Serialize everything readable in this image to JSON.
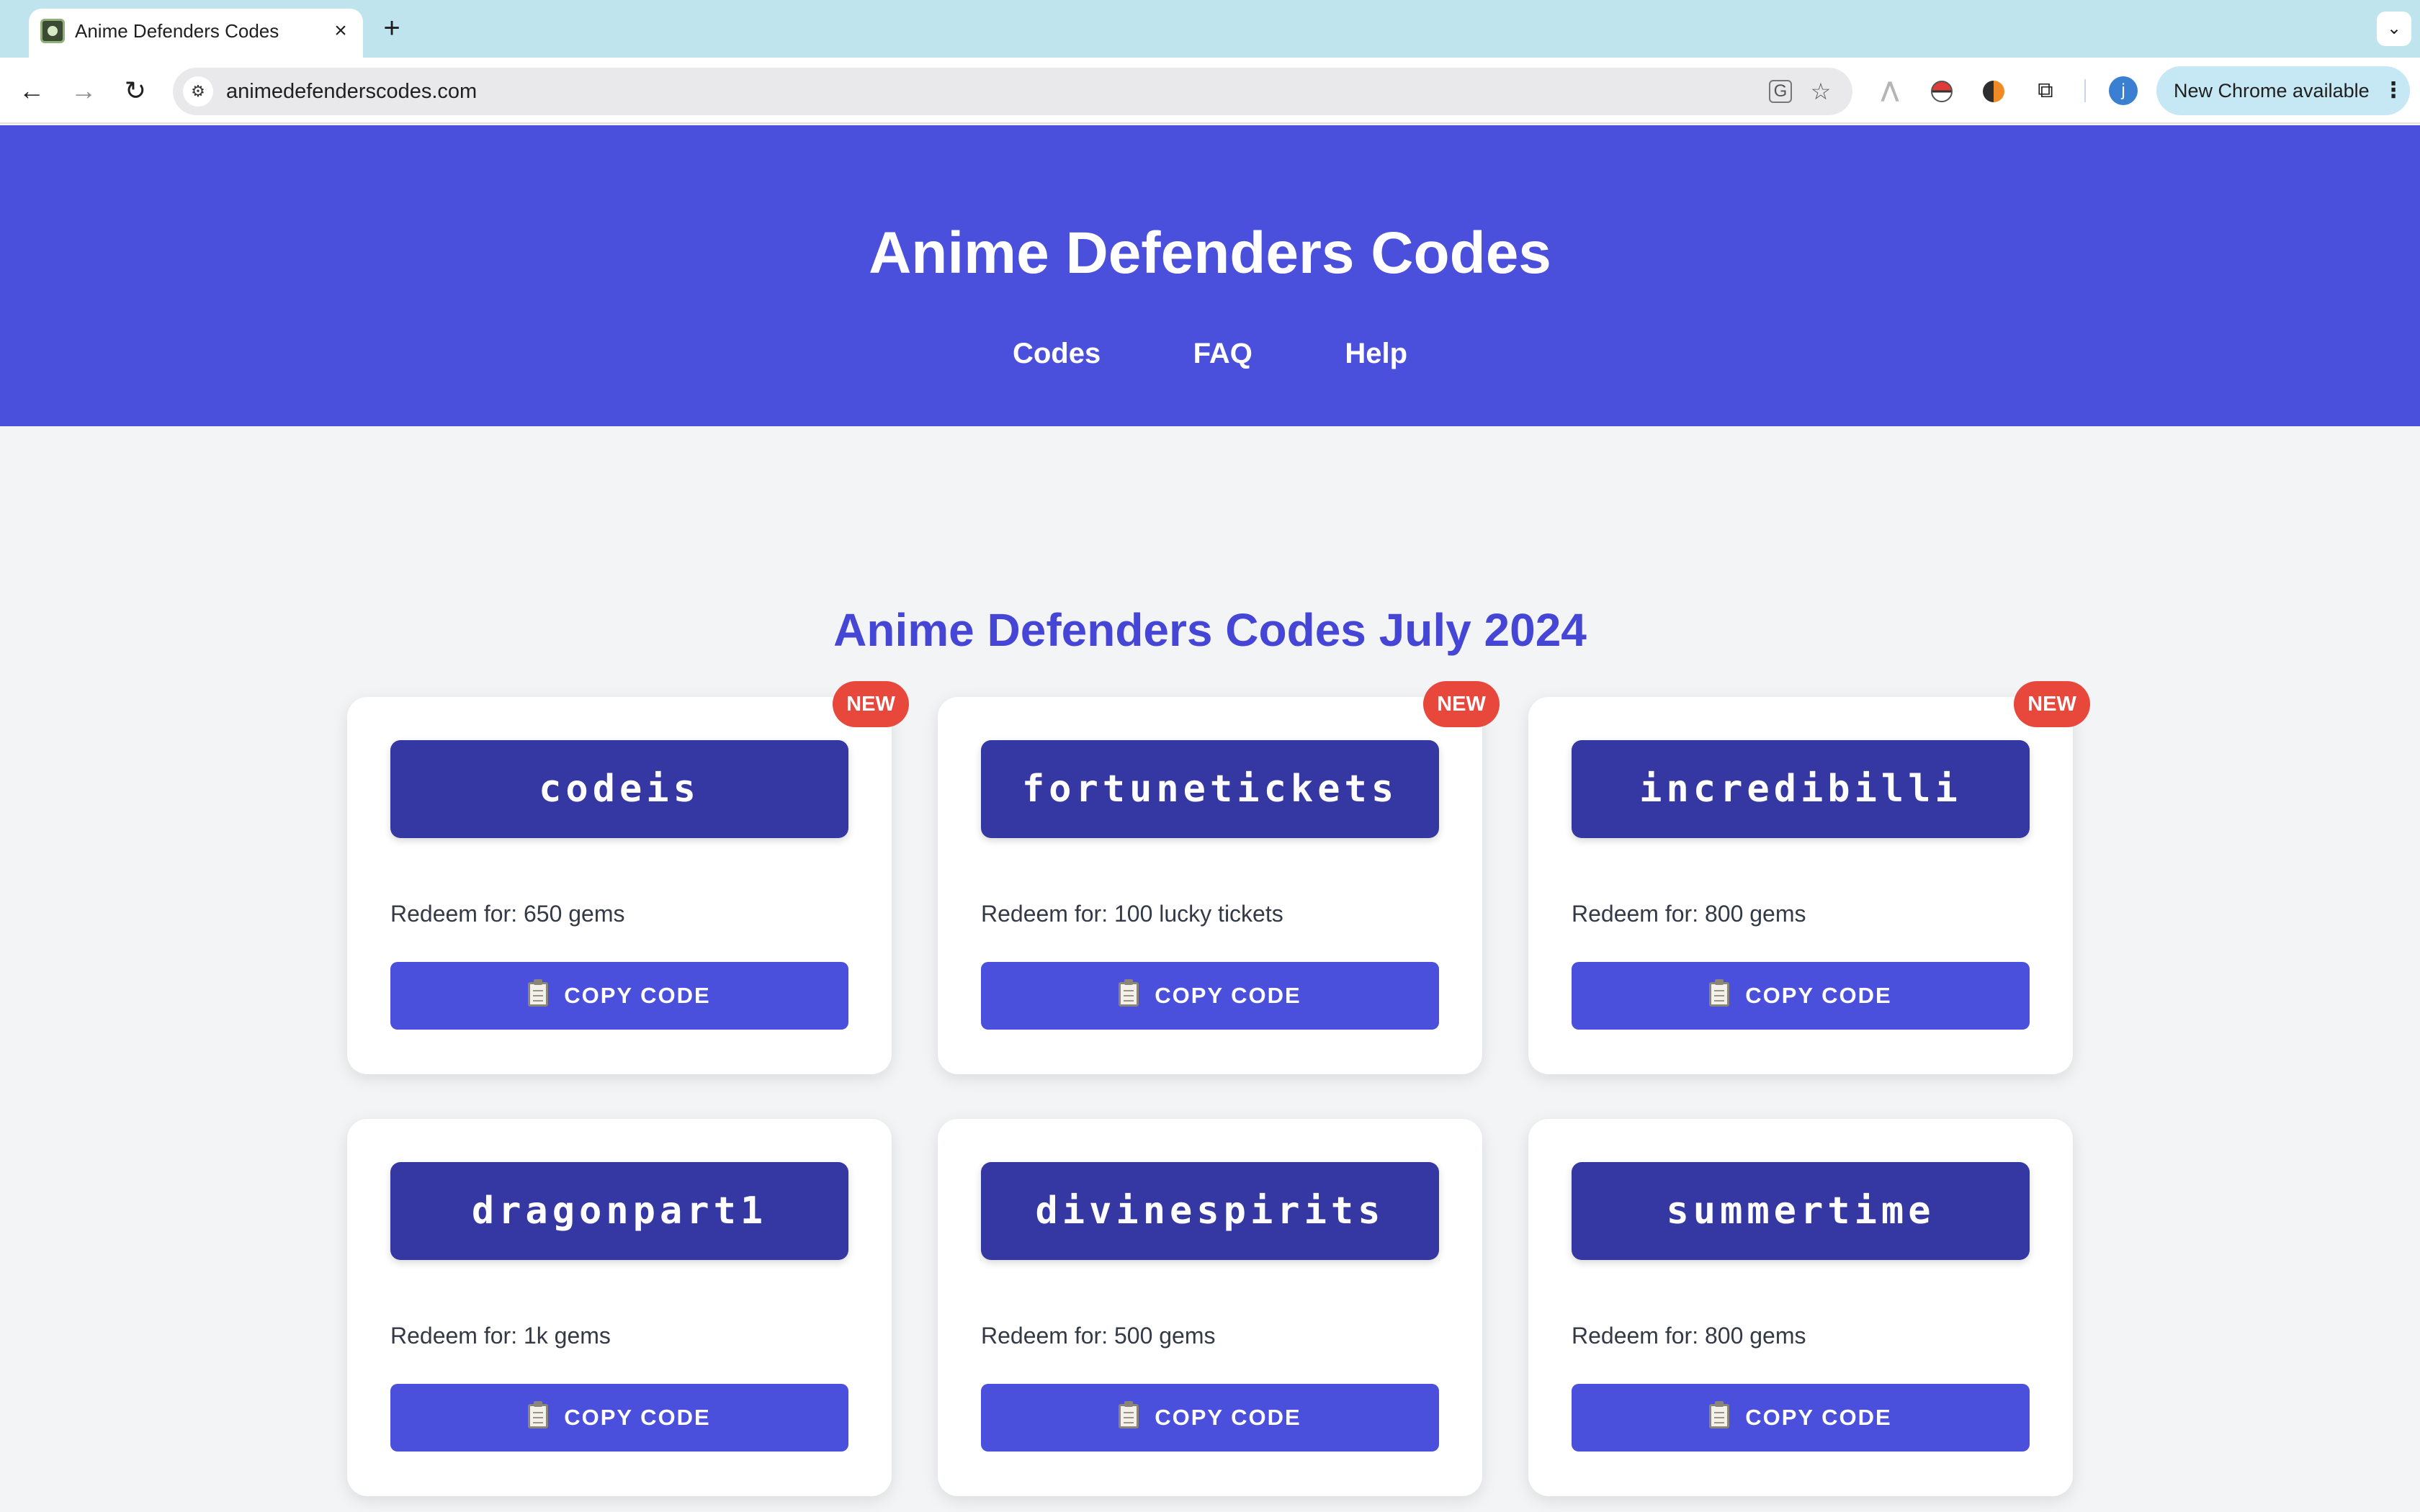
{
  "browser": {
    "tab_title": "Anime Defenders Codes",
    "tab_close": "×",
    "new_tab": "+",
    "tab_search": "⌄",
    "url": "animedefenderscodes.com",
    "update_label": "New Chrome available",
    "profile_initial": "j",
    "icons": {
      "back": "back-arrow-icon",
      "forward": "forward-arrow-icon",
      "reload": "reload-icon",
      "site_info": "tune-icon",
      "translate": "translate-icon",
      "bookmark": "star-icon",
      "extensions": "puzzle-icon",
      "menu": "kebab-menu-icon"
    }
  },
  "header": {
    "title": "Anime Defenders Codes",
    "nav": [
      "Codes",
      "FAQ",
      "Help"
    ],
    "color": "#4a4fdc"
  },
  "main": {
    "heading": "Anime Defenders Codes July 2024",
    "copy_label": "COPY CODE",
    "badge_label": "NEW",
    "cards": [
      {
        "code": "codeis",
        "reward": "Redeem for: 650 gems",
        "is_new": true
      },
      {
        "code": "fortunetickets",
        "reward": "Redeem for: 100 lucky tickets",
        "is_new": true
      },
      {
        "code": "incredibilli",
        "reward": "Redeem for: 800 gems",
        "is_new": true
      },
      {
        "code": "dragonpart1",
        "reward": "Redeem for: 1k gems",
        "is_new": false
      },
      {
        "code": "divinespirits",
        "reward": "Redeem for: 500 gems",
        "is_new": false
      },
      {
        "code": "summertime",
        "reward": "Redeem for: 800 gems",
        "is_new": false
      }
    ]
  },
  "colors": {
    "tabstrip": "#bfe4ee",
    "header": "#4a4fdc",
    "code_box": "#3537a2",
    "copy_button": "#4a4fdc",
    "badge": "#e8473c",
    "heading": "#4646d6",
    "page_bg": "#f3f4f6"
  }
}
